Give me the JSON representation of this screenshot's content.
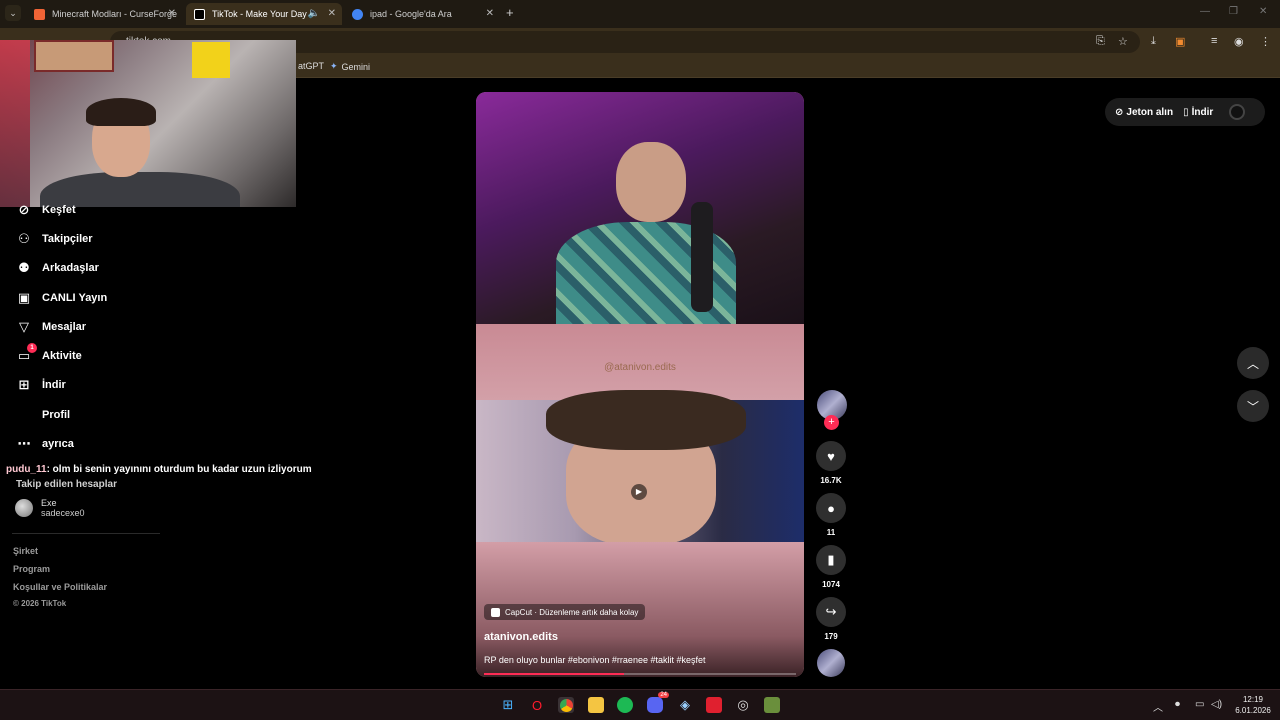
{
  "browser": {
    "tabs": [
      {
        "title": "Minecraft Modları - CurseForge",
        "active": false,
        "favicon_color": "#f16436"
      },
      {
        "title": "TikTok - Make Your Day",
        "active": true,
        "favicon_color": "#ffffff"
      },
      {
        "title": "ipad - Google'da Ara",
        "active": false,
        "favicon_color": "#4285f4"
      }
    ],
    "address_text": "tiktok.com",
    "bookmarks": [
      {
        "label": "atGPT"
      },
      {
        "label": "Gemini"
      }
    ]
  },
  "sidebar": {
    "items": [
      {
        "label": "Keşfet",
        "icon": "compass-icon",
        "glyph": "⊘"
      },
      {
        "label": "Takipçiler",
        "icon": "follow-user-icon",
        "glyph": "👤"
      },
      {
        "label": "Arkadaşlar",
        "icon": "friends-icon",
        "glyph": "👥"
      },
      {
        "label": "CANLI Yayın",
        "icon": "live-tv-icon",
        "glyph": "📺"
      },
      {
        "label": "Mesajlar",
        "icon": "send-icon",
        "glyph": "▽"
      },
      {
        "label": "Aktivite",
        "icon": "activity-icon",
        "glyph": "💬",
        "badge": "1"
      },
      {
        "label": "İndir",
        "icon": "download-plus-icon",
        "glyph": "⊞"
      },
      {
        "label": "Profil",
        "icon": "",
        "glyph": ""
      },
      {
        "label": "ayrıca",
        "icon": "more-icon",
        "glyph": "⋯"
      }
    ],
    "chat_user": "pudu_11",
    "chat_message": ": olm bi senin yayınını oturdum bu kadar uzun izliyorum",
    "followed_title": "Takip edilen hesaplar",
    "account_name": "Exe",
    "account_username": "sadecexe0",
    "footer": [
      "Şirket",
      "Program",
      "Koşullar ve Politikalar",
      "© 2026 TikTok"
    ]
  },
  "video": {
    "watermark": "@atanivon.edits",
    "capcut_label": "CapCut · Düzenleme artık daha kolay",
    "author": "atanivon.edits",
    "caption": "RP den oluyo bunlar #ebonivon #rraenee #taklit #keşfet",
    "progress": 0.45
  },
  "actions": {
    "likes": "16.7K",
    "comments": "11",
    "saves": "1074",
    "shares": "179"
  },
  "topright": {
    "coins": "Jeton alın",
    "download": "İndir"
  },
  "taskbar": {
    "time": "12:19",
    "date": "6.01.2026",
    "discord_badge": "24"
  },
  "colors": {
    "accent": "#fe2c55",
    "tab_bar": "#1f1a12",
    "toolbar": "#3a2f1c"
  }
}
